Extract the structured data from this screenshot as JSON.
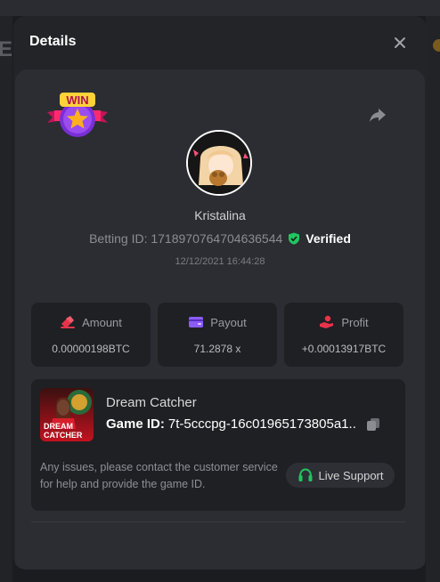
{
  "modal": {
    "title": "Details"
  },
  "bet": {
    "username": "Kristalina",
    "betting_id_label": "Betting ID: 1718970764704636544",
    "verified_label": "Verified",
    "timestamp": "12/12/2021 16:44:28",
    "badge_text": "WIN"
  },
  "stats": [
    {
      "label": "Amount",
      "value": "0.00000198BTC",
      "icon": "coins-icon"
    },
    {
      "label": "Payout",
      "value": "71.2878 x",
      "icon": "wallet-icon"
    },
    {
      "label": "Profit",
      "value": "+0.00013917BTC",
      "icon": "hand-coin-icon"
    }
  ],
  "game": {
    "name": "Dream Catcher",
    "id_label": "Game ID:",
    "id_value": "7t-5cccpg-16c01965173805a1...",
    "thumb_text_1": "DREAM",
    "thumb_text_2": "CATCHER",
    "note": "Any issues, please contact the customer service for help and provide the game ID.",
    "support_label": "Live Support"
  },
  "colors": {
    "accent_green": "#22c55e",
    "accent_red": "#e8344a",
    "accent_purple": "#8b5cf6"
  }
}
